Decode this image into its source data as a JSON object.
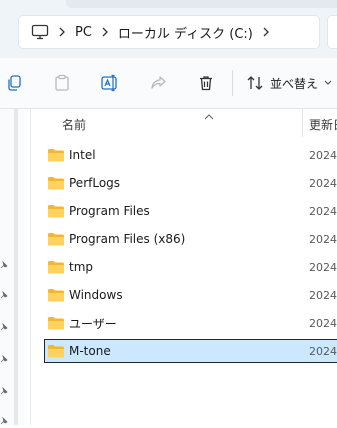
{
  "address": {
    "segments": [
      "PC",
      "ローカル ディスク (C:)"
    ]
  },
  "toolbar": {
    "sort_label": "並べ替え"
  },
  "columns": {
    "name": "名前",
    "date": "更新日"
  },
  "files": [
    {
      "name": "Intel",
      "date": "2024/"
    },
    {
      "name": "PerfLogs",
      "date": "2024/"
    },
    {
      "name": "Program Files",
      "date": "2024/"
    },
    {
      "name": "Program Files (x86)",
      "date": "2024/"
    },
    {
      "name": "tmp",
      "date": "2024/"
    },
    {
      "name": "Windows",
      "date": "2024/"
    },
    {
      "name": "ユーザー",
      "date": "2024/"
    },
    {
      "name": "M-tone",
      "date": "2024/",
      "selected": true
    }
  ],
  "colors": {
    "selection": "#cce8ff",
    "folder": "#ffc83d"
  }
}
